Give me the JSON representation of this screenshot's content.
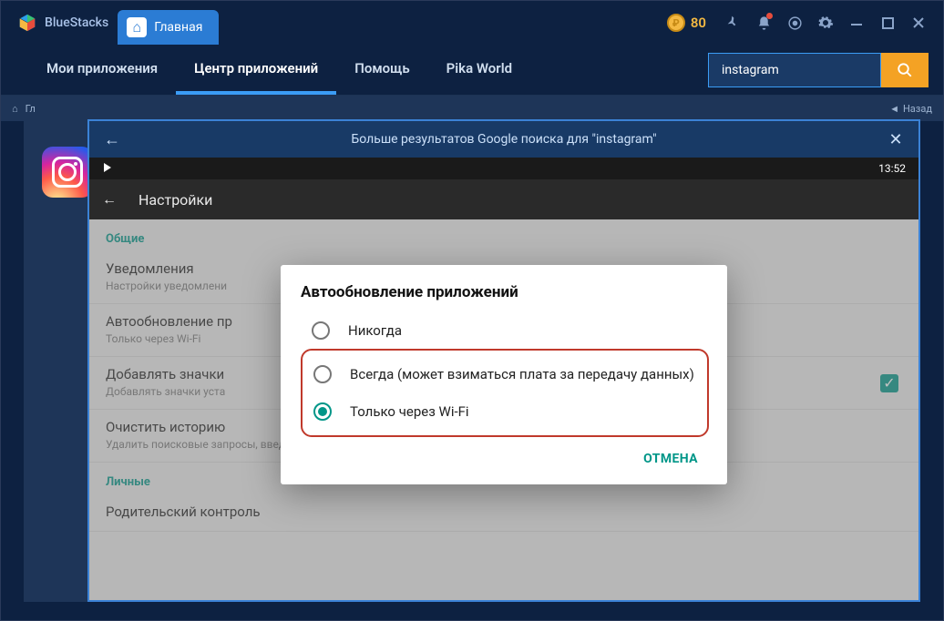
{
  "titlebar": {
    "logo_text": "BlueStacks",
    "tab_home": "Главная",
    "coins": "80"
  },
  "mainnav": {
    "items": [
      "Мои приложения",
      "Центр приложений",
      "Помощь",
      "Pika World"
    ],
    "search_value": "instagram"
  },
  "breadcrumb": {
    "first": "Гл",
    "back": "Назад"
  },
  "modal": {
    "title": "Больше результатов Google поиска для \"instagram\""
  },
  "android": {
    "time": "13:52",
    "settings_header": "Настройки",
    "sections": {
      "general": "Общие",
      "personal": "Личные"
    },
    "rows": [
      {
        "title": "Уведомления",
        "sub": "Настройки уведомлени"
      },
      {
        "title": "Автообновление пр",
        "sub": "Только через Wi-Fi"
      },
      {
        "title": "Добавлять значки",
        "sub": "Добавлять значки уста"
      },
      {
        "title": "Очистить историю",
        "sub": "Удалить поисковые запросы, введенные на этом устройстве"
      },
      {
        "title": "Родительский контроль",
        "sub": ""
      }
    ]
  },
  "dialog": {
    "title": "Автообновление приложений",
    "options": [
      "Никогда",
      "Всегда (может взиматься плата за передачу данных)",
      "Только через Wi-Fi"
    ],
    "selected_index": 2,
    "cancel": "ОТМЕНА"
  }
}
